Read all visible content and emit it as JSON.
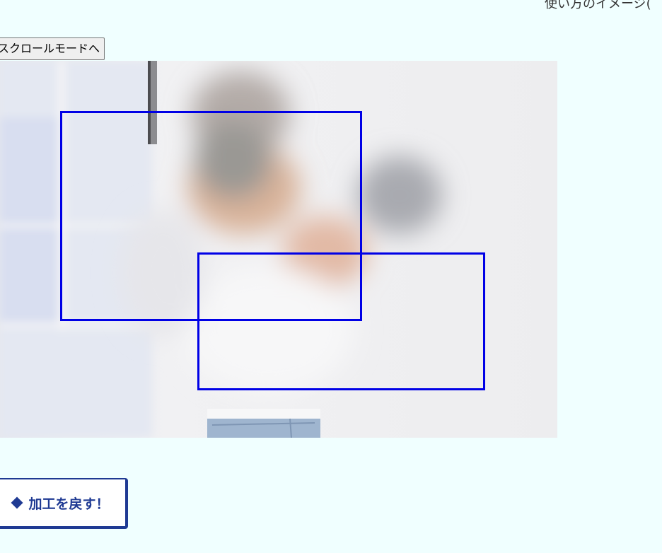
{
  "header": {
    "hint_text": "使い方のイメージ("
  },
  "toolbar": {
    "mode_button_label": "スクロールモードへ"
  },
  "canvas": {
    "photo_subject": "blurred person in white sweater and jeans against white wall",
    "region_count": 2,
    "box_color": "#0000e6"
  },
  "actions": {
    "undo_label": "加工を戻す！",
    "undo_icon": "eraser-icon"
  }
}
